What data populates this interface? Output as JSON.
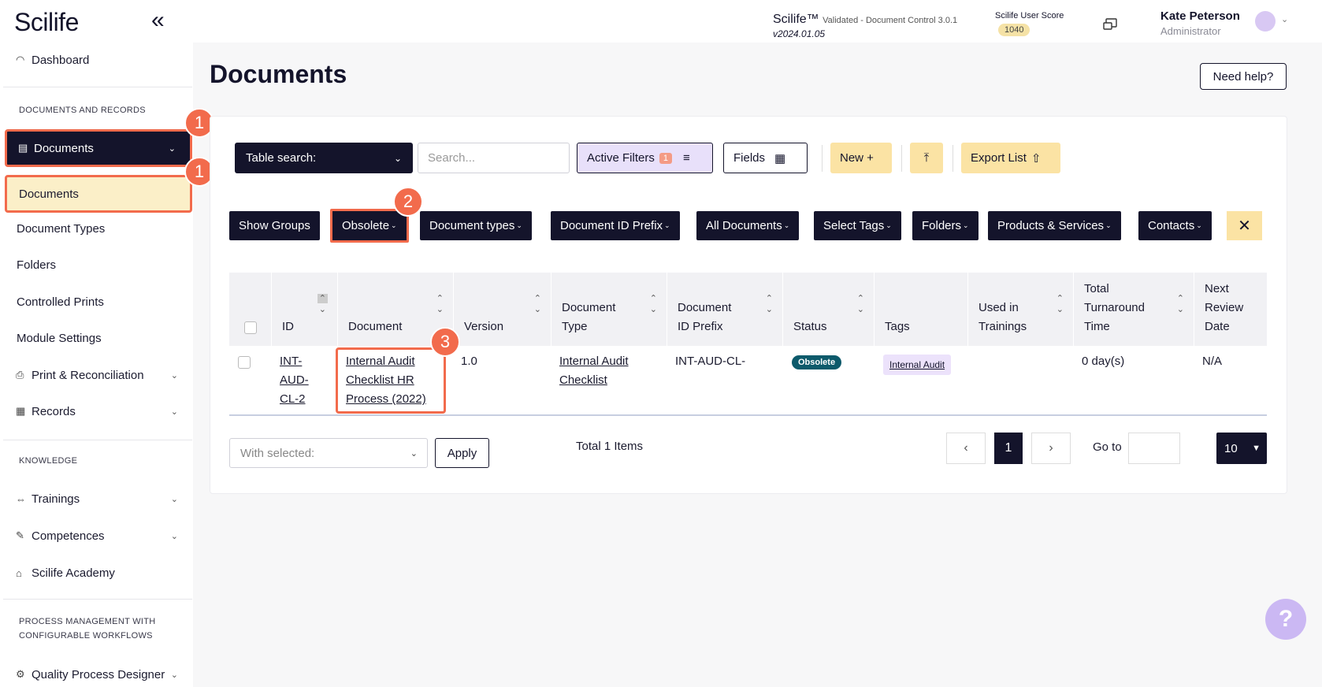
{
  "sidebar": {
    "logo": "Scilife",
    "dashboard": "Dashboard",
    "section_docs": "DOCUMENTS AND RECORDS",
    "documents_group": "Documents",
    "sub_items": [
      "Documents",
      "Document Types",
      "Folders",
      "Controlled Prints",
      "Module Settings"
    ],
    "print_reconciliation": "Print & Reconciliation",
    "records": "Records",
    "section_knowledge": "KNOWLEDGE",
    "trainings": "Trainings",
    "competences": "Competences",
    "academy": "Scilife Academy",
    "section_process_1": "PROCESS MANAGEMENT WITH",
    "section_process_2": "CONFIGURABLE WORKFLOWS",
    "quality_designer": "Quality Process Designer"
  },
  "header": {
    "app_name": "Scilife™",
    "app_sub": "Validated - Document Control 3.0.1",
    "version": "v2024.01.05",
    "score_label": "Scilife User Score",
    "score_value": "1040",
    "user_name": "Kate Peterson",
    "user_role": "Administrator"
  },
  "page": {
    "title": "Documents",
    "help_button": "Need help?"
  },
  "toolbar": {
    "table_search": "Table search:",
    "search_placeholder": "Search...",
    "active_filters": "Active Filters",
    "active_filters_count": "1",
    "fields": "Fields",
    "new": "New +",
    "export": "Export List"
  },
  "filters": [
    "Show Groups",
    "Obsolete",
    "Document types",
    "Document ID Prefix",
    "All Documents",
    "Select Tags",
    "Folders",
    "Products & Services",
    "Contacts"
  ],
  "table": {
    "columns": {
      "id": "ID",
      "document": "Document",
      "version": "Version",
      "doc_type_1": "Document",
      "doc_type_2": "Type",
      "prefix_1": "Document",
      "prefix_2": "ID Prefix",
      "status": "Status",
      "tags": "Tags",
      "used_1": "Used in",
      "used_2": "Trainings",
      "tat_1": "Total",
      "tat_2": "Turnaround",
      "tat_3": "Time",
      "nrd_1": "Next",
      "nrd_2": "Review",
      "nrd_3": "Date"
    },
    "rows": [
      {
        "id_1": "INT-",
        "id_2": "AUD-",
        "id_3": "CL-2",
        "doc_1": "Internal Audit",
        "doc_2": "Checklist HR",
        "doc_3": "Process (2022)",
        "version": "1.0",
        "type_1": "Internal Audit",
        "type_2": "Checklist",
        "prefix": "INT-AUD-CL-",
        "status": "Obsolete",
        "tag": "Internal Audit",
        "tat": "0 day(s)",
        "next_review": "N/A"
      }
    ]
  },
  "footer": {
    "with_selected": "With selected:",
    "apply": "Apply",
    "total": "Total 1 Items",
    "current_page": "1",
    "goto": "Go to",
    "page_size": "10"
  },
  "annotations": [
    "1",
    "1",
    "2",
    "3"
  ],
  "colors": {
    "navy": "#14142b",
    "highlight": "#f26b4c",
    "yellow": "#fbe3a4",
    "lavender": "#e8e0fa",
    "status_teal": "#0d5a6b"
  }
}
